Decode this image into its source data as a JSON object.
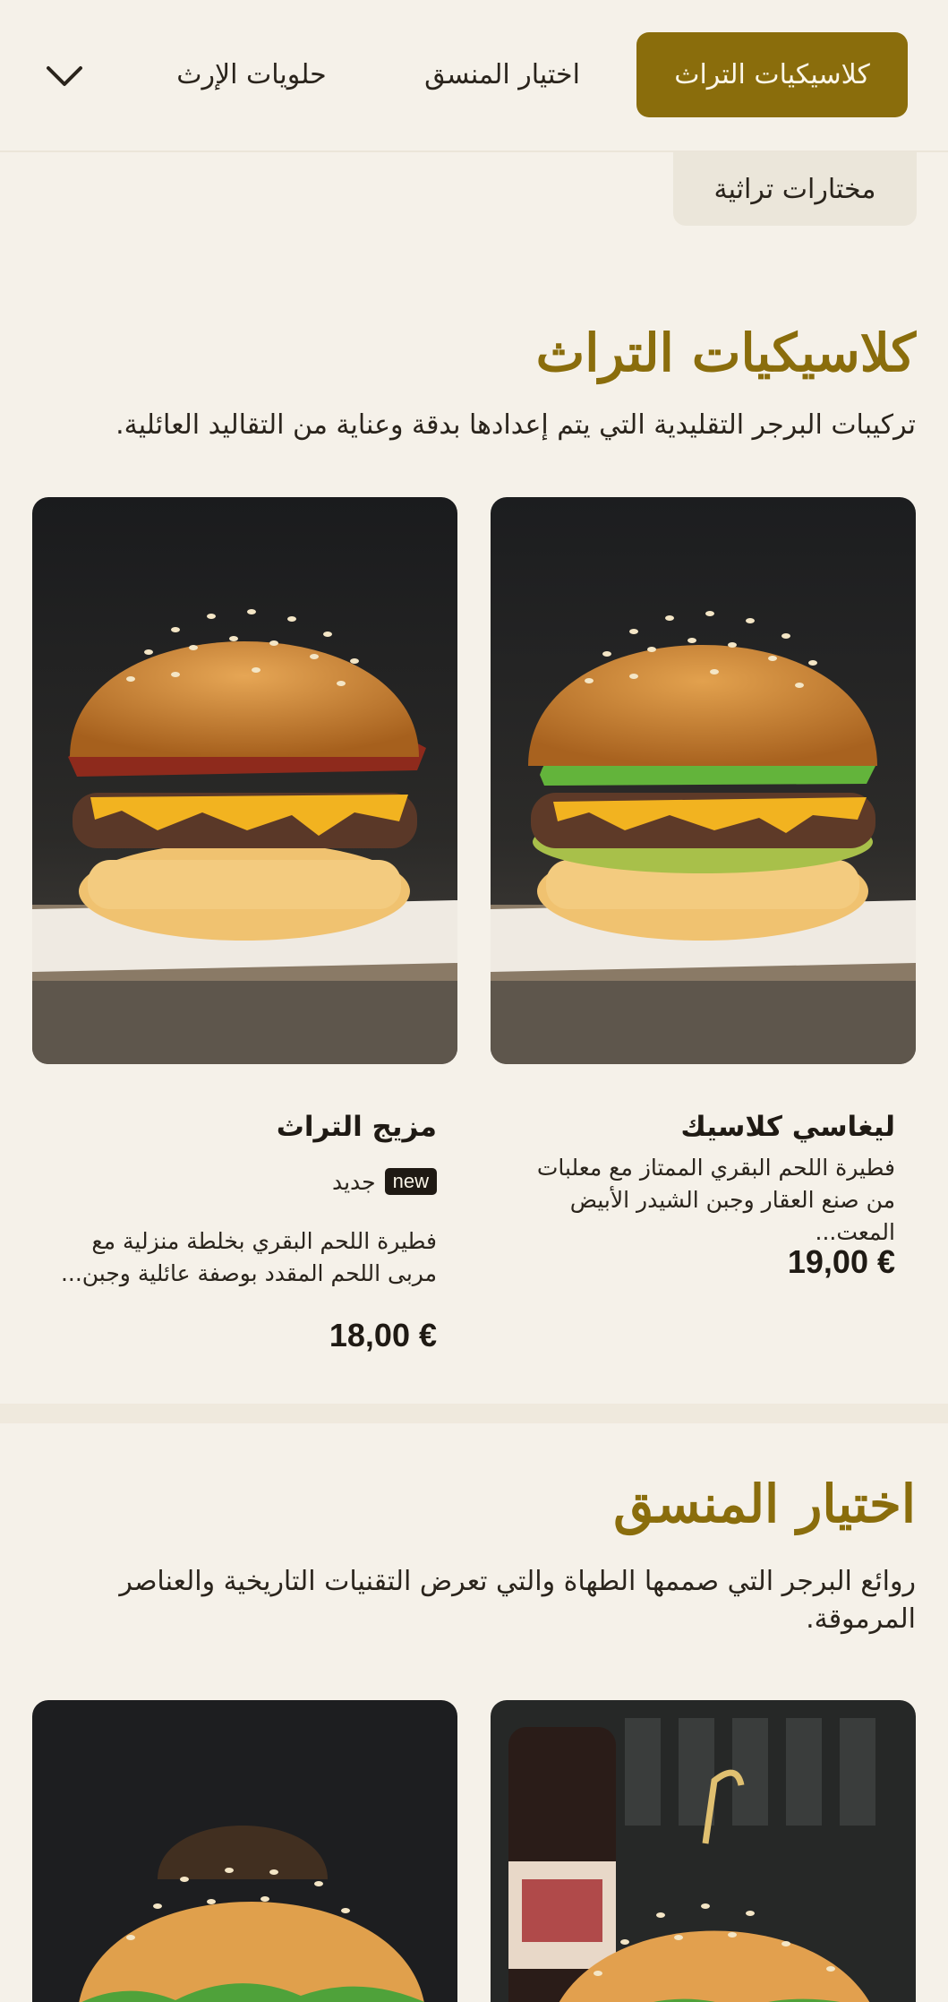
{
  "nav": {
    "tabs": [
      {
        "label": "كلاسيكيات التراث",
        "active": true
      },
      {
        "label": "اختيار المنسق",
        "active": false
      },
      {
        "label": "حلويات الإرث",
        "active": false
      }
    ],
    "more_icon": "chevron-down-icon",
    "sub_tab": "مختارات تراثية"
  },
  "colors": {
    "accent": "#8a6d0c",
    "background": "#f5f1e9"
  },
  "sections": [
    {
      "title": "كلاسيكيات التراث",
      "description": "تركيبات البرجر التقليدية التي يتم إعدادها بدقة وعناية من التقاليد العائلية.",
      "items": [
        {
          "name": "ليغاسي كلاسيك",
          "description": "فطيرة اللحم البقري الممتاز مع معلبات من صنع العقار وجبن الشيدر الأبيض المعت...",
          "price": "19,00 €"
        },
        {
          "name": "مزيج التراث",
          "badge": "new",
          "badge_label": "جديد",
          "description": "فطيرة اللحم البقري بخلطة منزلية مع مربى اللحم المقدد بوصفة عائلية وجبن...",
          "price": "18,00 €"
        }
      ]
    },
    {
      "title": "اختيار المنسق",
      "description": "روائع البرجر التي صممها الطهاة والتي تعرض التقنيات التاريخية والعناصر المرموقة."
    }
  ]
}
